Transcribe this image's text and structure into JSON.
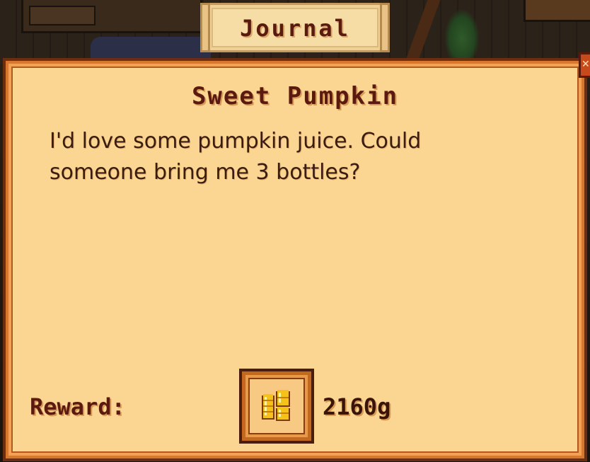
{
  "journal": {
    "tab_label": "Journal"
  },
  "quest": {
    "title": "Sweet Pumpkin",
    "description": "I'd love some pumpkin juice. Could someone bring me 3 bottles?",
    "reward_label": "Reward:",
    "reward_amount": "2160g",
    "reward_icon": "gold-coins-icon",
    "close_icon": "close-icon"
  },
  "colors": {
    "panel_bg": "#fbd692",
    "panel_border": "#6b2e12",
    "title_text": "#5a1a10",
    "body_text": "#3a1c10"
  }
}
